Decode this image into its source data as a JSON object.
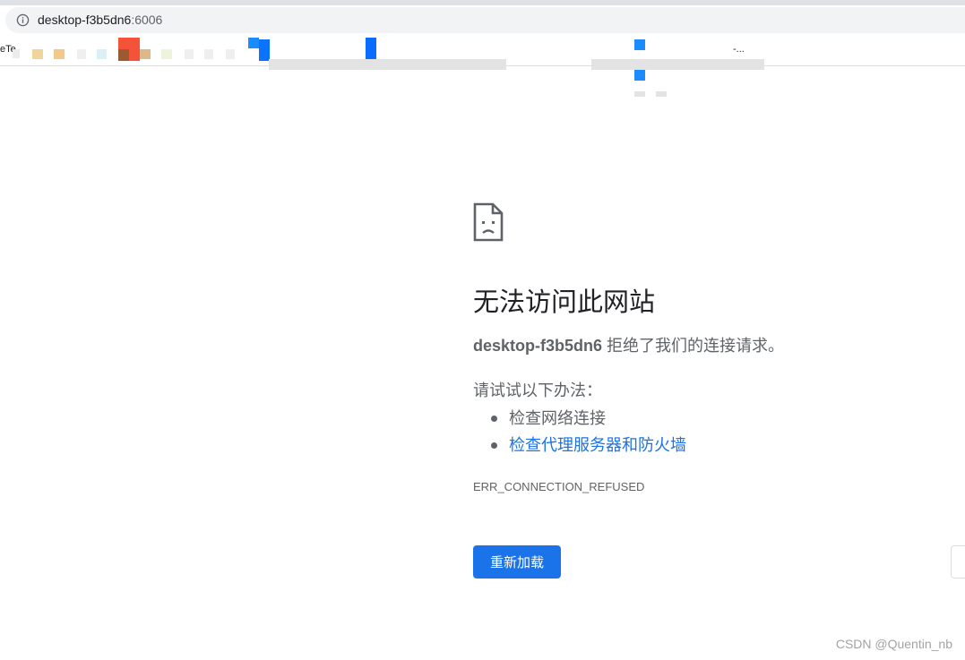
{
  "address_bar": {
    "host": "desktop-f3b5dn6",
    "port": ":6006"
  },
  "bookmarks_bar": {
    "leading_text": "eTe",
    "trailing_text": "-..."
  },
  "error_page": {
    "title": "无法访问此网站",
    "host": "desktop-f3b5dn6",
    "message": " 拒绝了我们的连接请求。",
    "suggestions_heading": "请试试以下办法：",
    "suggestions": [
      {
        "text": "检查网络连接",
        "is_link": false
      },
      {
        "text": "检查代理服务器和防火墙",
        "is_link": true
      }
    ],
    "error_code": "ERR_CONNECTION_REFUSED",
    "reload_label": "重新加载"
  },
  "watermark": "CSDN @Quentin_nb",
  "colors": {
    "accent": "#1a73e8",
    "text_primary": "#202124",
    "text_secondary": "#5f6368"
  }
}
